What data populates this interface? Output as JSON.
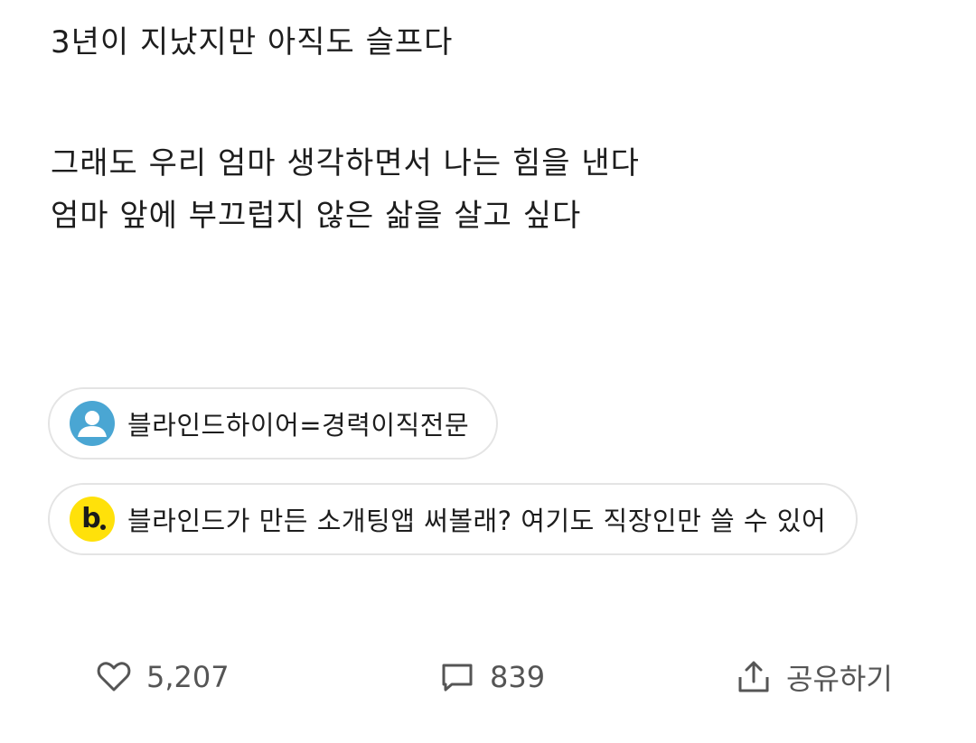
{
  "post": {
    "lines": [
      "3년이 지났지만 아직도 슬프다",
      "",
      "그래도 우리 엄마 생각하면서 나는 힘을 낸다",
      "엄마 앞에 부끄럽지 않은 삶을 살고 싶다"
    ]
  },
  "promos": [
    {
      "icon": "profile-icon",
      "label": "블라인드하이어=경력이직전문",
      "color": "#4aa6d3"
    },
    {
      "icon": "blind-logo-icon",
      "label": "블라인드가 만든 소개팅앱 써볼래? 여기도 직장인만 쓸 수 있어",
      "color": "#ffe10a"
    }
  ],
  "actions": {
    "like_count": "5,207",
    "comment_count": "839",
    "share_label": "공유하기"
  }
}
